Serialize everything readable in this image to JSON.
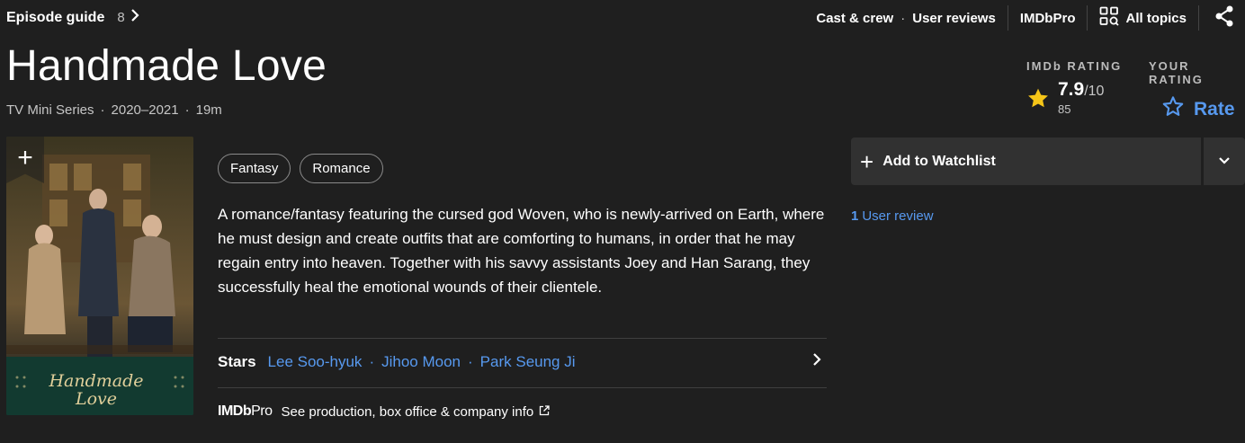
{
  "topbar": {
    "episode_guide": "Episode guide",
    "episode_count": "8",
    "cast_crew": "Cast & crew",
    "user_reviews": "User reviews",
    "imdbpro": "IMDbPro",
    "all_topics": "All topics"
  },
  "title": "Handmade Love",
  "meta": {
    "type": "TV Mini Series",
    "years": "2020–2021",
    "runtime": "19m"
  },
  "imdb_rating": {
    "label": "IMDb RATING",
    "score": "7.9",
    "out_of": "/10",
    "votes": "85"
  },
  "your_rating": {
    "label": "YOUR RATING",
    "action": "Rate"
  },
  "poster": {
    "title_line1": "Handmade",
    "title_line2": "Love"
  },
  "genres": [
    "Fantasy",
    "Romance"
  ],
  "plot": "A romance/fantasy featuring the cursed god Woven, who is newly-arrived on Earth, where he must design and create outfits that are comforting to humans, in order that he may regain entry into heaven. Together with his savvy assistants Joey and Han Sarang, they successfully heal the emotional wounds of their clientele.",
  "stars": {
    "label": "Stars",
    "names": [
      "Lee Soo-hyuk",
      "Jihoo Moon",
      "Park Seung Ji"
    ]
  },
  "pro": {
    "logo_a": "IMDb",
    "logo_b": "Pro",
    "text": "See production, box office & company info"
  },
  "watchlist": {
    "label": "Add to Watchlist"
  },
  "reviews": {
    "count": "1",
    "label": "User review"
  },
  "colors": {
    "accent_blue": "#5799ef",
    "star_yellow": "#f5c518",
    "background": "#1f1f1f"
  }
}
